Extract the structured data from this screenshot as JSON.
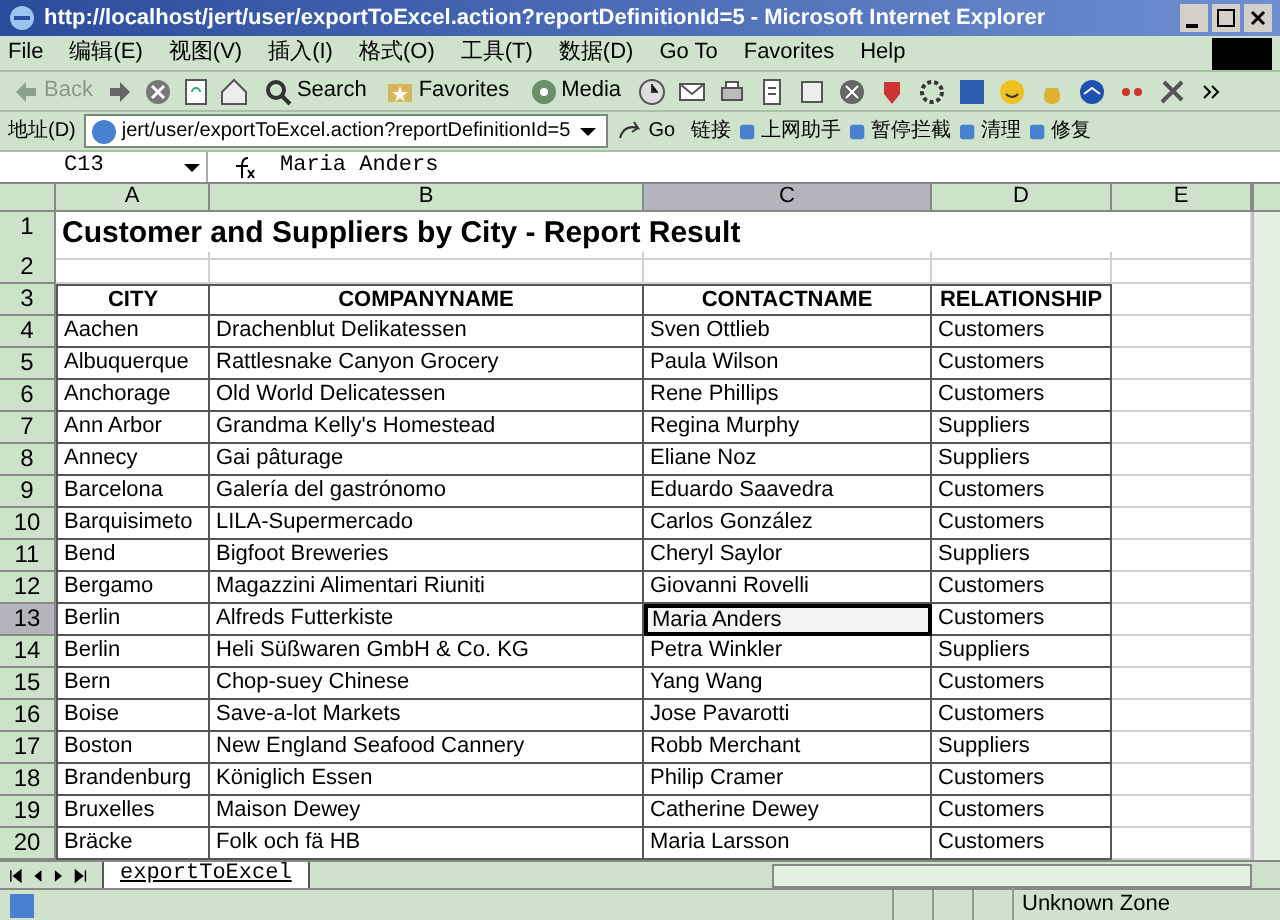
{
  "window": {
    "title": "http://localhost/jert/user/exportToExcel.action?reportDefinitionId=5 - Microsoft Internet Explorer"
  },
  "menu_bar": {
    "items": [
      "File",
      "编辑(E)",
      "视图(V)",
      "插入(I)",
      "格式(O)",
      "工具(T)",
      "数据(D)",
      "Go To",
      "Favorites",
      "Help"
    ]
  },
  "toolbar": {
    "buttons": [
      {
        "kind": "back",
        "label": "Back",
        "disabled": true
      },
      {
        "kind": "search",
        "label": "Search",
        "disabled": false
      },
      {
        "kind": "favorites",
        "label": "Favorites",
        "disabled": false
      },
      {
        "kind": "media",
        "label": "Media",
        "disabled": false
      }
    ]
  },
  "address_bar": {
    "label": "地址(D)",
    "url": "jert/user/exportToExcel.action?reportDefinitionId=5",
    "go": "Go",
    "links": "链接",
    "tools": [
      "上网助手",
      "暂停拦截",
      "清理",
      "修复"
    ]
  },
  "formula_bar": {
    "cell": "C13",
    "value": "Maria Anders"
  },
  "sheet": {
    "columns": [
      {
        "label": "A",
        "selected": false
      },
      {
        "label": "B",
        "selected": false
      },
      {
        "label": "C",
        "selected": true
      },
      {
        "label": "D",
        "selected": false
      },
      {
        "label": "E",
        "selected": false
      }
    ],
    "row_headers": [
      {
        "label": "1",
        "selected": false
      },
      {
        "label": "2",
        "selected": false
      },
      {
        "label": "3",
        "selected": false
      },
      {
        "label": "4",
        "selected": false
      },
      {
        "label": "5",
        "selected": false
      },
      {
        "label": "6",
        "selected": false
      },
      {
        "label": "7",
        "selected": false
      },
      {
        "label": "8",
        "selected": false
      },
      {
        "label": "9",
        "selected": false
      },
      {
        "label": "10",
        "selected": false
      },
      {
        "label": "11",
        "selected": false
      },
      {
        "label": "12",
        "selected": false
      },
      {
        "label": "13",
        "selected": true
      },
      {
        "label": "14",
        "selected": false
      },
      {
        "label": "15",
        "selected": false
      },
      {
        "label": "16",
        "selected": false
      },
      {
        "label": "17",
        "selected": false
      },
      {
        "label": "18",
        "selected": false
      },
      {
        "label": "19",
        "selected": false
      },
      {
        "label": "20",
        "selected": false
      }
    ],
    "title": "Customer and Suppliers by City - Report Result",
    "headers": [
      "CITY",
      "COMPANYNAME",
      "CONTACTNAME",
      "RELATIONSHIP"
    ],
    "records": [
      {
        "city": "Aachen",
        "company": "Drachenblut Delikatessen",
        "contact": "Sven Ottlieb",
        "relationship": "Customers",
        "active": false
      },
      {
        "city": "Albuquerque",
        "company": "Rattlesnake Canyon Grocery",
        "contact": "Paula Wilson",
        "relationship": "Customers",
        "active": false
      },
      {
        "city": "Anchorage",
        "company": "Old World Delicatessen",
        "contact": "Rene Phillips",
        "relationship": "Customers",
        "active": false
      },
      {
        "city": "Ann Arbor",
        "company": "Grandma Kelly's Homestead",
        "contact": "Regina Murphy",
        "relationship": "Suppliers",
        "active": false
      },
      {
        "city": "Annecy",
        "company": "Gai pâturage",
        "contact": "Eliane Noz",
        "relationship": "Suppliers",
        "active": false
      },
      {
        "city": "Barcelona",
        "company": "Galería del gastrónomo",
        "contact": "Eduardo Saavedra",
        "relationship": "Customers",
        "active": false
      },
      {
        "city": "Barquisimeto",
        "company": "LILA-Supermercado",
        "contact": "Carlos González",
        "relationship": "Customers",
        "active": false
      },
      {
        "city": "Bend",
        "company": "Bigfoot Breweries",
        "contact": "Cheryl Saylor",
        "relationship": "Suppliers",
        "active": false
      },
      {
        "city": "Bergamo",
        "company": "Magazzini Alimentari Riuniti",
        "contact": "Giovanni Rovelli",
        "relationship": "Customers",
        "active": false
      },
      {
        "city": "Berlin",
        "company": "Alfreds Futterkiste",
        "contact": "Maria Anders",
        "relationship": "Customers",
        "active": true
      },
      {
        "city": "Berlin",
        "company": "Heli Süßwaren GmbH & Co. KG",
        "contact": "Petra Winkler",
        "relationship": "Suppliers",
        "active": false
      },
      {
        "city": "Bern",
        "company": "Chop-suey Chinese",
        "contact": "Yang Wang",
        "relationship": "Customers",
        "active": false
      },
      {
        "city": "Boise",
        "company": "Save-a-lot Markets",
        "contact": "Jose Pavarotti",
        "relationship": "Customers",
        "active": false
      },
      {
        "city": "Boston",
        "company": "New England Seafood Cannery",
        "contact": "Robb Merchant",
        "relationship": "Suppliers",
        "active": false
      },
      {
        "city": "Brandenburg",
        "company": "Königlich Essen",
        "contact": "Philip Cramer",
        "relationship": "Customers",
        "active": false
      },
      {
        "city": "Bruxelles",
        "company": "Maison Dewey",
        "contact": "Catherine Dewey",
        "relationship": "Customers",
        "active": false
      },
      {
        "city": "Bräcke",
        "company": "Folk och fä HB",
        "contact": "Maria Larsson",
        "relationship": "Customers",
        "active": false
      }
    ]
  },
  "sheet_tabs": [
    {
      "label": "exportToExcel",
      "selected": true
    }
  ],
  "status_bar": {
    "zone": "Unknown Zone"
  }
}
